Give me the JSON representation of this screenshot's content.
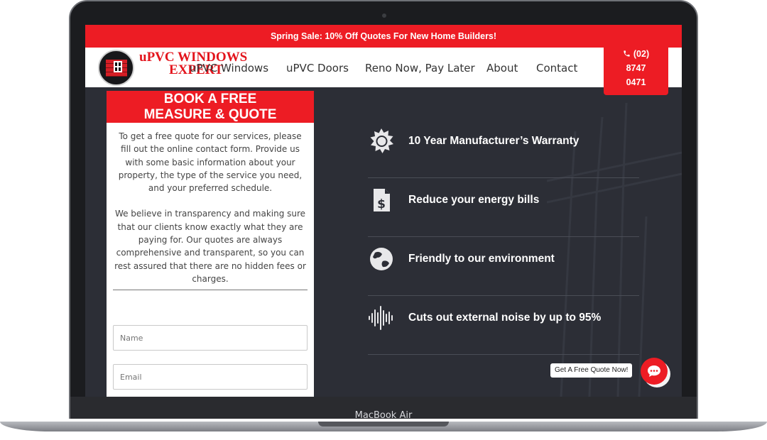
{
  "device": {
    "label": "MacBook Air"
  },
  "promo_bar": {
    "text": "Spring Sale: 10% Off Quotes For New Home Builders!"
  },
  "header": {
    "logo_line1": "uPVC WINDOWS",
    "logo_line2": "EXPERT",
    "nav": [
      "uPVC Windows",
      "uPVC Doors",
      "Reno Now, Pay Later",
      "About",
      "Contact"
    ],
    "phone_line1": "(02)",
    "phone_line2": "8747",
    "phone_line3": "0471",
    "phone_icon": "phone-icon"
  },
  "quote_card": {
    "title_line1": "BOOK A FREE",
    "title_line2": "MEASURE & QUOTE",
    "paragraph1": "To get a free quote for our services, please fill out the online contact form. Provide us with some basic information about your property, the type of the service you need, and your preferred schedule.",
    "paragraph2": "We believe in transparency and making sure that our clients know exactly what they are paying for. Our quotes are always comprehensive and transparent, so you can rest assured that there are no hidden fees or charges.",
    "name_placeholder": "Name",
    "email_placeholder": "Email"
  },
  "features": [
    {
      "icon": "badge-icon",
      "label": "10 Year Manufacturer’s Warranty"
    },
    {
      "icon": "bill-icon",
      "label": "Reduce your energy bills"
    },
    {
      "icon": "globe-icon",
      "label": "Friendly to our environment"
    },
    {
      "icon": "soundwave-icon",
      "label": "Cuts out external noise by up to 95%"
    }
  ],
  "chat": {
    "cta": "Get A Free Quote Now!",
    "icon": "chat-icon"
  },
  "colors": {
    "accent": "#ed1c24",
    "dark_bg": "#2c2e36",
    "white": "#ffffff"
  }
}
